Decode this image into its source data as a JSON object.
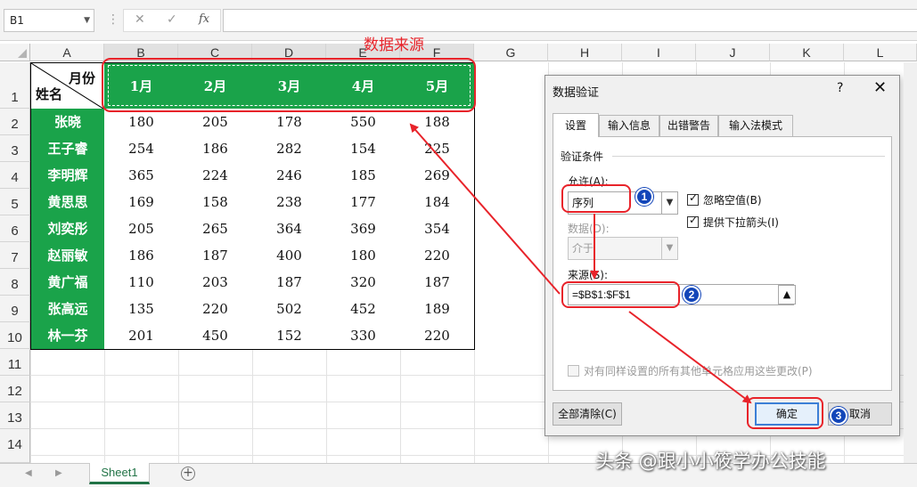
{
  "formula_bar": {
    "name_box": "B1",
    "cancel_icon": "✕",
    "confirm_icon": "✓",
    "fx_label": "fx",
    "formula": ""
  },
  "columns": [
    "A",
    "B",
    "C",
    "D",
    "E",
    "F",
    "G",
    "H",
    "I",
    "J",
    "K",
    "L"
  ],
  "rows": [
    "1",
    "2",
    "3",
    "4",
    "5",
    "6",
    "7",
    "8",
    "9",
    "10",
    "11",
    "12",
    "13",
    "14"
  ],
  "sheet": {
    "corner_top": "月份",
    "corner_bottom": "姓名",
    "months": [
      "1月",
      "2月",
      "3月",
      "4月",
      "5月"
    ],
    "data": [
      {
        "name": "张晓",
        "values": [
          "180",
          "205",
          "178",
          "550",
          "188"
        ]
      },
      {
        "name": "王子睿",
        "values": [
          "254",
          "186",
          "282",
          "154",
          "225"
        ]
      },
      {
        "name": "李明辉",
        "values": [
          "365",
          "224",
          "246",
          "185",
          "269"
        ]
      },
      {
        "name": "黄思思",
        "values": [
          "169",
          "158",
          "238",
          "177",
          "184"
        ]
      },
      {
        "name": "刘奕彤",
        "values": [
          "205",
          "265",
          "364",
          "369",
          "354"
        ]
      },
      {
        "name": "赵丽敏",
        "values": [
          "186",
          "187",
          "400",
          "180",
          "220"
        ]
      },
      {
        "name": "黄广福",
        "values": [
          "110",
          "203",
          "187",
          "320",
          "187"
        ]
      },
      {
        "name": "张高远",
        "values": [
          "135",
          "220",
          "502",
          "452",
          "189"
        ]
      },
      {
        "name": "林一芬",
        "values": [
          "201",
          "450",
          "152",
          "330",
          "220"
        ]
      }
    ]
  },
  "annotation": {
    "source_label": "数据来源",
    "step1": "1",
    "step2": "2",
    "step3": "3"
  },
  "dialog": {
    "title": "数据验证",
    "help": "?",
    "close": "✕",
    "tabs": [
      "设置",
      "输入信息",
      "出错警告",
      "输入法模式"
    ],
    "group_label": "验证条件",
    "allow_label": "允许(A):",
    "allow_value": "序列",
    "ignore_blank": "忽略空值(B)",
    "dropdown_arrow": "提供下拉箭头(I)",
    "data_label": "数据(D):",
    "data_value": "介于",
    "source_label": "来源(S):",
    "source_value": "=$B$1:$F$1",
    "apply_all": "对有同样设置的所有其他单元格应用这些更改(P)",
    "clear_all": "全部清除(C)",
    "ok": "确定",
    "cancel": "取消"
  },
  "sheet_tabs": {
    "active": "Sheet1",
    "add": "+"
  },
  "watermark": "头条 @跟小小筱学办公技能",
  "colors": {
    "header_green": "#1aa34a",
    "annotation_red": "#e8232a",
    "step_blue": "#1346b9",
    "excel_green": "#217346"
  }
}
